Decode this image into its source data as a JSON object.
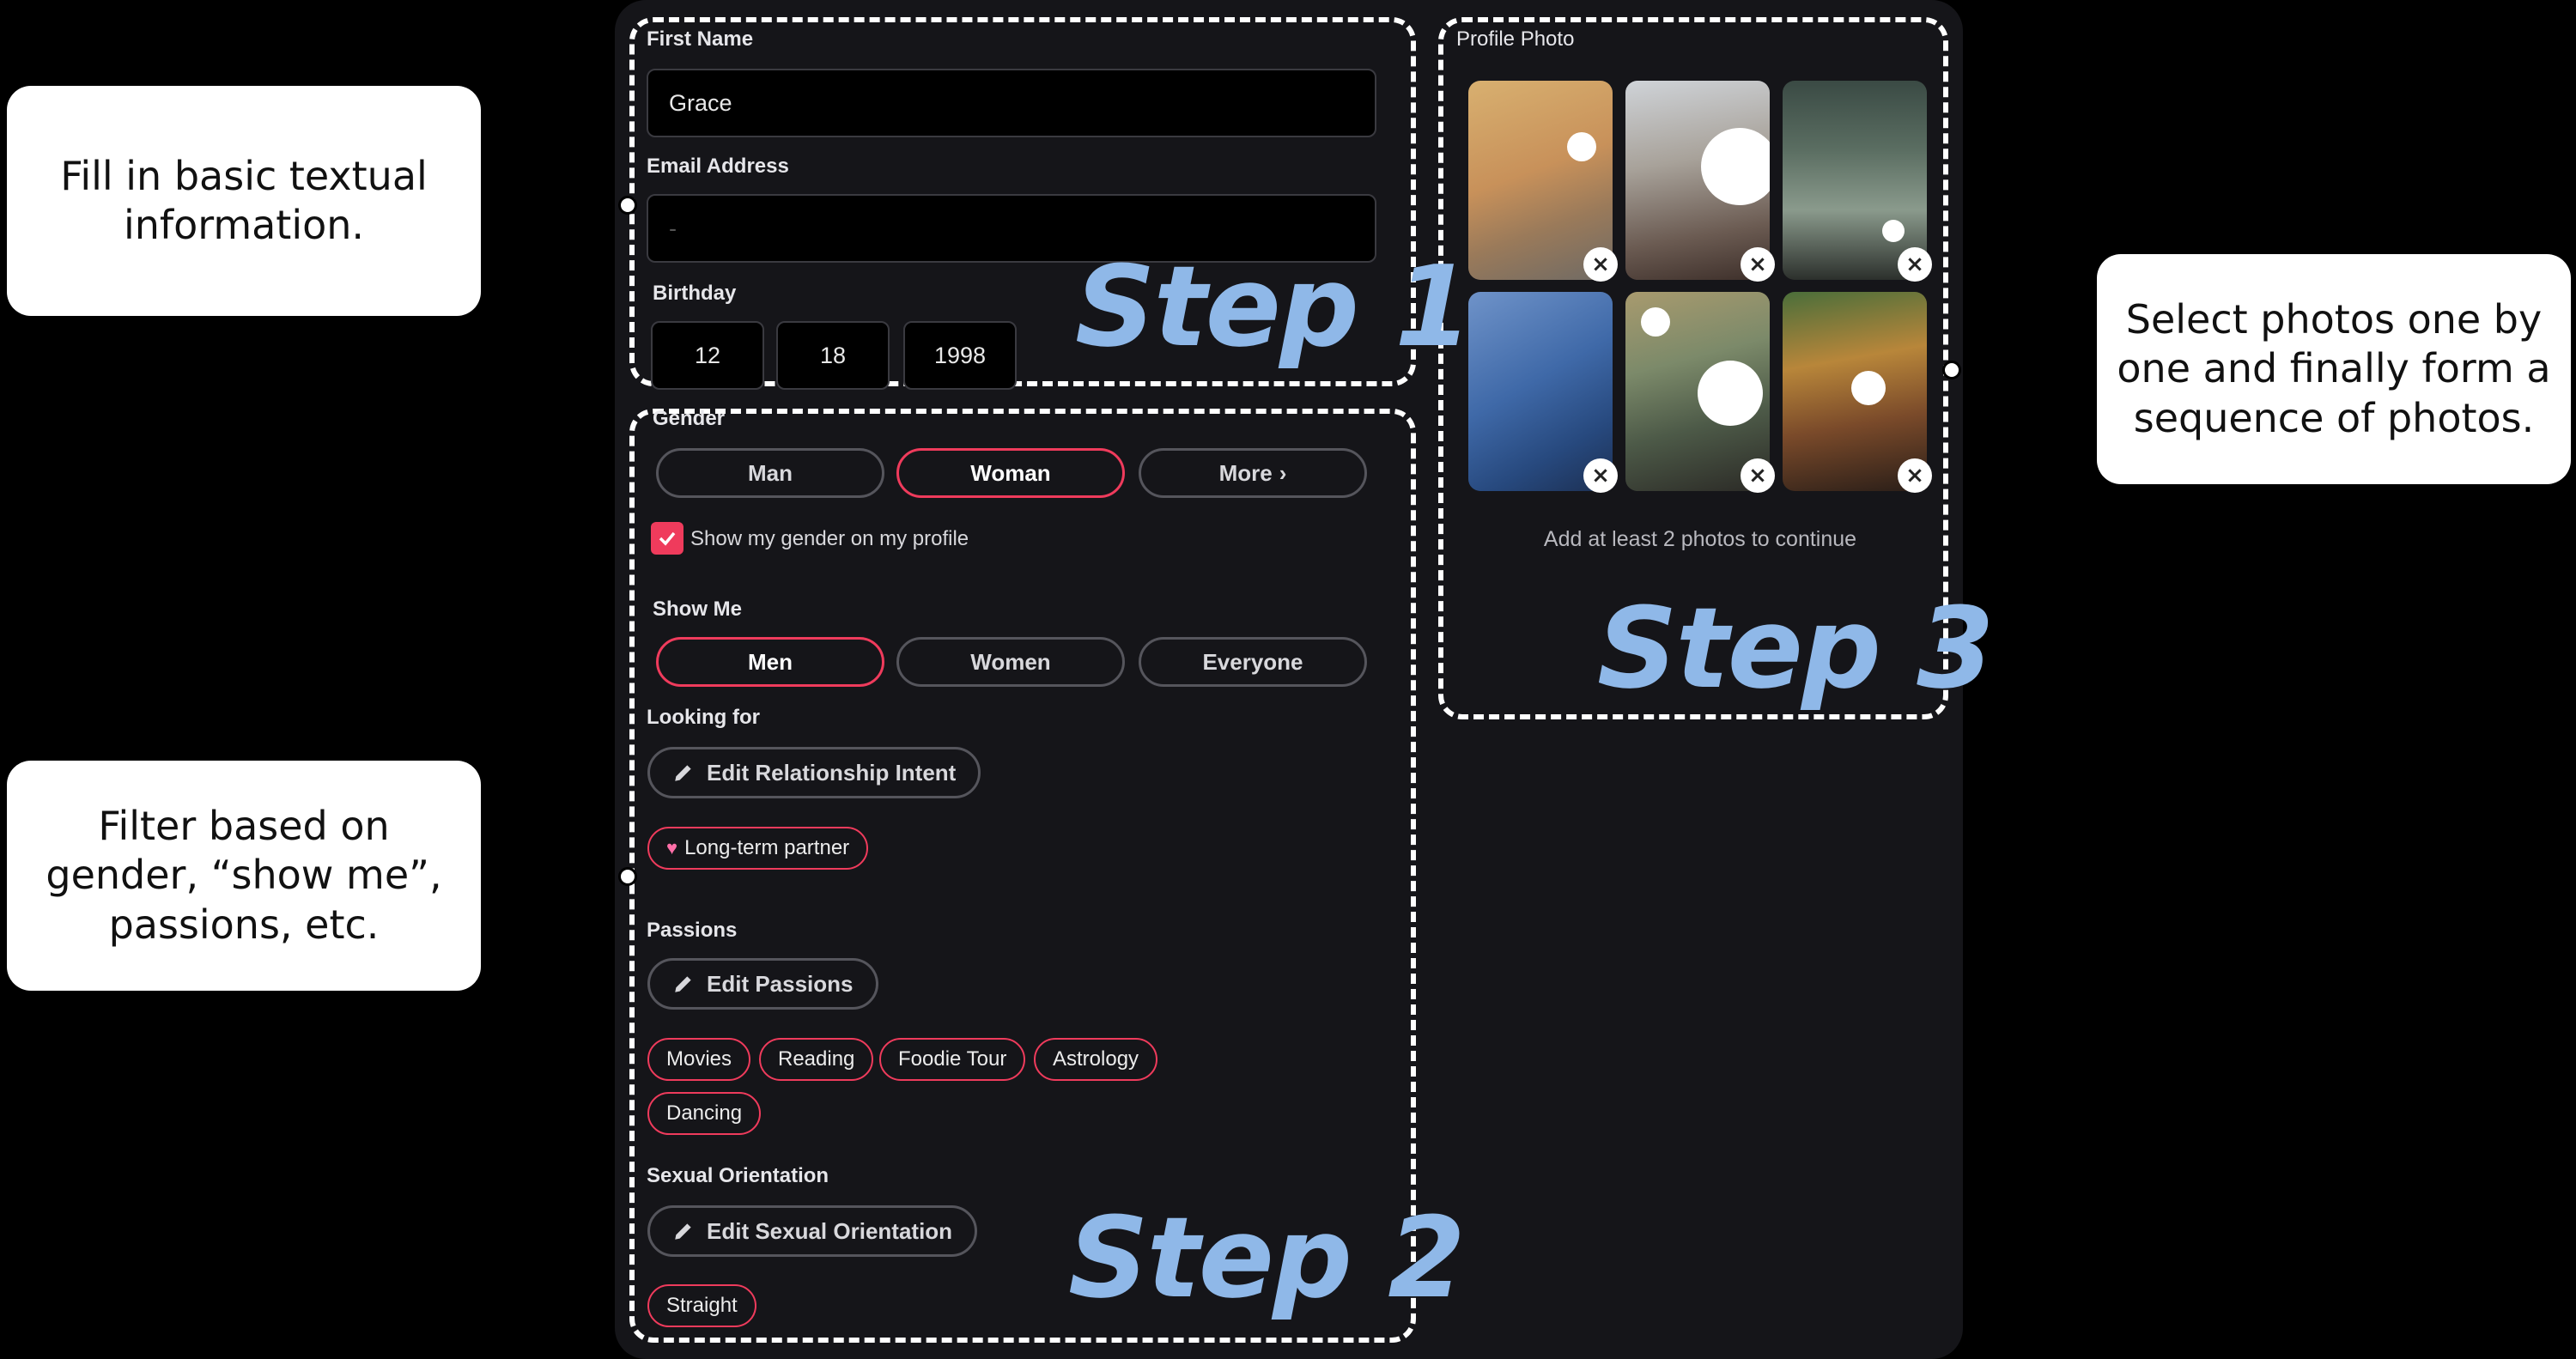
{
  "annotations": {
    "step1_note": "Fill in basic textual information.",
    "step2_note": "Filter based on gender, “show me”, passions, etc.",
    "step3_note": "Select photos one by one and finally form a sequence of photos.",
    "step1": "Step 1",
    "step2": "Step 2",
    "step3": "Step 3"
  },
  "form": {
    "first_name_label": "First Name",
    "first_name_value": "Grace",
    "email_label": "Email Address",
    "email_value": "-",
    "birthday_label": "Birthday",
    "birthday_month": "12",
    "birthday_day": "18",
    "birthday_year": "1998",
    "gender_label": "Gender",
    "gender_options": [
      "Man",
      "Woman",
      "More"
    ],
    "gender_selected": "Woman",
    "show_gender_text": "Show my gender on my profile",
    "show_gender_checked": true,
    "show_me_label": "Show Me",
    "show_me_options": [
      "Men",
      "Women",
      "Everyone"
    ],
    "show_me_selected": "Men",
    "looking_for_label": "Looking for",
    "edit_intent_label": "Edit Relationship Intent",
    "intent_tag": "Long-term partner",
    "passions_label": "Passions",
    "edit_passions_label": "Edit Passions",
    "passions": [
      "Movies",
      "Reading",
      "Foodie Tour",
      "Astrology",
      "Dancing"
    ],
    "orientation_label": "Sexual Orientation",
    "edit_orientation_label": "Edit Sexual Orientation",
    "orientation_tag": "Straight"
  },
  "photos": {
    "label": "Profile Photo",
    "hint": "Add at least 2 photos to continue",
    "count": 6
  },
  "colors": {
    "accent": "#ef3b5c",
    "panel_bg": "#151519",
    "step_text": "#8fb8e8"
  }
}
